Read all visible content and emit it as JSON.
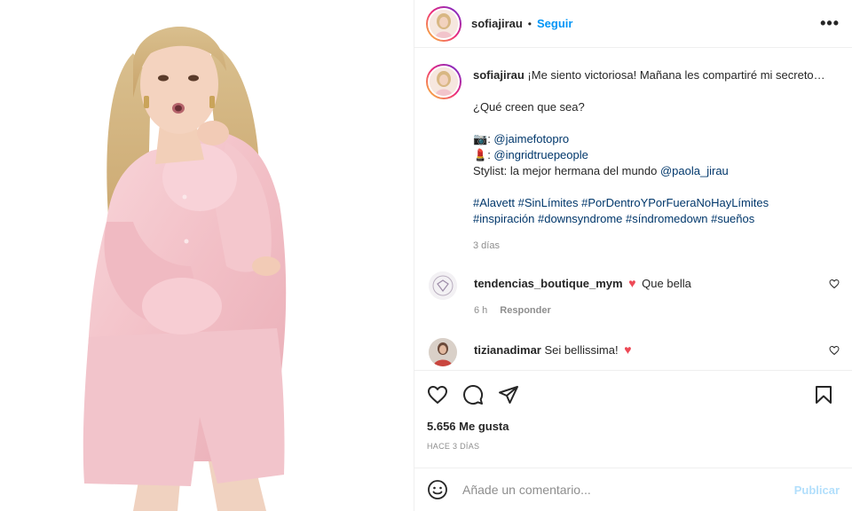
{
  "post": {
    "username": "sofiajirau",
    "separator": "•",
    "follow_label": "Seguir",
    "more_label": "•••"
  },
  "caption": {
    "username": "sofiajirau",
    "line1": "¡Me siento victoriosa! Mañana les compartiré mi secreto…",
    "line2": "¿Qué creen que sea?",
    "credit1_emoji": "📷",
    "credit1_sep": ": ",
    "credit1_handle": "@jaimefotopro",
    "credit2_emoji": "💄",
    "credit2_sep": ": ",
    "credit2_handle": "@ingridtruepeople",
    "stylist_prefix": "Stylist: la mejor hermana del mundo ",
    "stylist_handle": "@paola_jirau",
    "hashtags_line1": "#Alavett #SinLímites #PorDentroYPorFueraNoHayLímites",
    "hashtags_line2": "#inspiración #downsyndrome #síndromedown #sueños",
    "time": "3 días"
  },
  "comments": [
    {
      "username": "tendencias_boutique_mym",
      "heart": "♥",
      "text": "Que bella",
      "time": "6 h",
      "reply_label": "Responder"
    },
    {
      "username": "tizianadimar",
      "text": "Sei bellissima!",
      "heart": "♥"
    }
  ],
  "stats": {
    "likes": "5.656 Me gusta",
    "time_ago": "HACE 3 DÍAS"
  },
  "composer": {
    "placeholder": "Añade un comentario...",
    "publish_label": "Publicar"
  },
  "colors": {
    "accent": "#0095f6",
    "link": "#00376b",
    "heart": "#ed4956",
    "publish_disabled": "#b2dffc",
    "muted": "#8e8e8e",
    "pajama_pink": "#f3c6cb"
  }
}
